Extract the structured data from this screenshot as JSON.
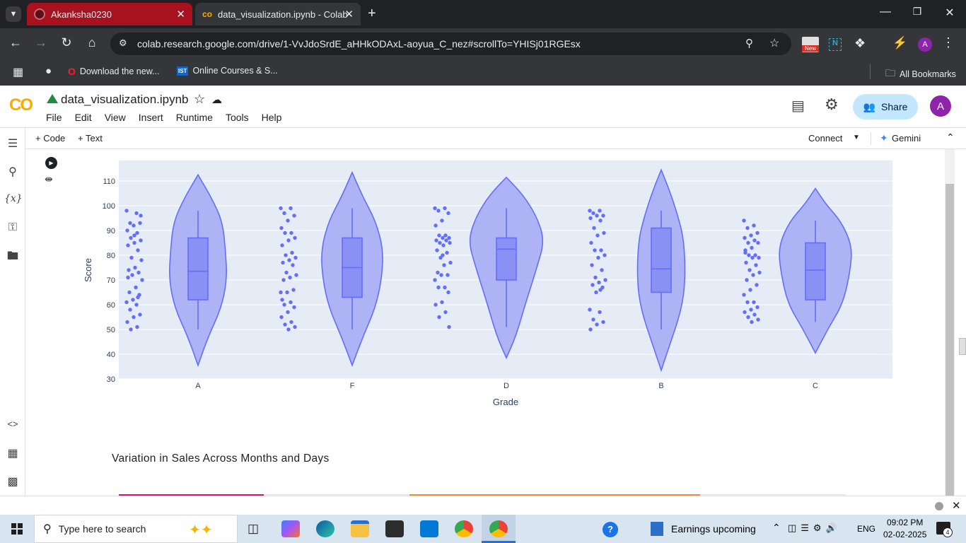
{
  "browser": {
    "tabs": [
      {
        "title": "Akanksha0230",
        "active": false
      },
      {
        "title": "data_visualization.ipynb - Colab",
        "active": true
      }
    ],
    "url": "colab.research.google.com/drive/1-VvJdoSrdE_aHHkODAxL-aoyua_C_nez#scrollTo=YHISj01RGEsx",
    "bookmarks": [
      "Download the new...",
      "Online Courses & S..."
    ],
    "all_bookmarks": "All Bookmarks",
    "new_badge": "New"
  },
  "colab": {
    "notebook_name": "data_visualization.ipynb",
    "menu": [
      "File",
      "Edit",
      "View",
      "Insert",
      "Runtime",
      "Tools",
      "Help"
    ],
    "share_label": "Share",
    "avatar_letter": "A",
    "add_code": "+ Code",
    "add_text": "+ Text",
    "connect": "Connect",
    "gemini": "Gemini",
    "section_heading": "Variation in Sales Across Months and Days"
  },
  "chart_data": {
    "type": "violin",
    "title": "",
    "xlabel": "Grade",
    "ylabel": "Score",
    "ylim": [
      30,
      115
    ],
    "yticks": [
      30,
      40,
      50,
      60,
      70,
      80,
      90,
      100,
      110
    ],
    "categories": [
      "A",
      "F",
      "D",
      "B",
      "C"
    ],
    "grid": true,
    "colors": {
      "fill": "#a4a9f6",
      "line": "#636efa",
      "bg": "#e5ecf6"
    },
    "boxes": [
      {
        "q1": 62,
        "median": 73.5,
        "q3": 87,
        "lower": 50,
        "upper": 98,
        "kde_min": 35.5,
        "kde_max": 112.5
      },
      {
        "q1": 63,
        "median": 75,
        "q3": 87,
        "lower": 50,
        "upper": 99,
        "kde_min": 35.5,
        "kde_max": 113.5
      },
      {
        "q1": 70,
        "median": 82.5,
        "q3": 87,
        "lower": 51,
        "upper": 99,
        "kde_min": 38.5,
        "kde_max": 111.5
      },
      {
        "q1": 65,
        "median": 74.5,
        "q3": 91,
        "lower": 50,
        "upper": 98,
        "kde_min": 33.5,
        "kde_max": 114.5
      },
      {
        "q1": 62,
        "median": 74,
        "q3": 85,
        "lower": 53,
        "upper": 94,
        "kde_min": 40.5,
        "kde_max": 107
      }
    ],
    "points": [
      [
        98,
        97,
        93,
        93,
        92,
        90,
        89,
        87,
        86,
        85,
        84,
        82,
        79,
        78,
        75,
        74,
        73,
        72,
        70,
        67,
        65,
        64,
        62,
        61,
        60,
        58,
        56,
        55,
        53,
        51,
        50,
        96,
        88,
        71,
        63
      ],
      [
        99,
        99,
        97,
        96,
        94,
        91,
        89,
        89,
        87,
        86,
        84,
        81,
        80,
        79,
        78,
        77,
        76,
        73,
        72,
        71,
        70,
        66,
        65,
        65,
        61,
        60,
        59,
        57,
        55,
        53,
        52,
        51,
        50,
        62
      ],
      [
        99,
        99,
        98,
        97,
        94,
        92,
        88,
        88,
        87,
        87,
        86,
        86,
        85,
        85,
        84,
        82,
        81,
        79,
        77,
        76,
        73,
        72,
        72,
        70,
        67,
        67,
        65,
        61,
        60,
        57,
        55,
        51,
        80
      ],
      [
        98,
        98,
        97,
        96,
        96,
        95,
        94,
        91,
        89,
        88,
        85,
        82,
        82,
        80,
        79,
        76,
        74,
        71,
        70,
        69,
        68,
        67,
        65,
        58,
        57,
        54,
        53,
        52,
        50,
        66
      ],
      [
        94,
        92,
        91,
        89,
        88,
        87,
        86,
        85,
        85,
        83,
        81,
        80,
        80,
        79,
        79,
        77,
        76,
        74,
        73,
        72,
        70,
        68,
        66,
        64,
        61,
        61,
        59,
        58,
        57,
        56,
        55,
        54,
        53,
        82
      ]
    ]
  },
  "taskbar": {
    "search_placeholder": "Type here to search",
    "weather": "Earnings upcoming",
    "lang": "ENG",
    "time": "09:02 PM",
    "date": "02-02-2025",
    "notif_count": "4"
  }
}
